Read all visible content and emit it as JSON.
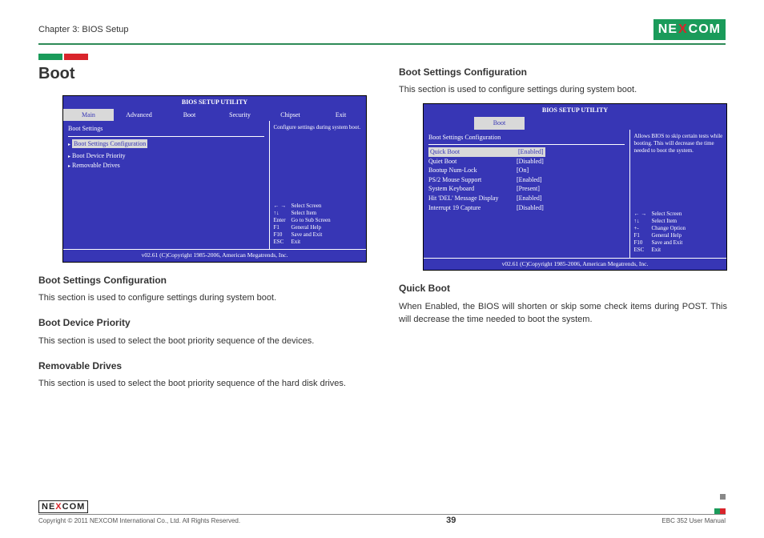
{
  "header": {
    "chapter": "Chapter 3: BIOS Setup",
    "logo_text": "NE COM",
    "logo_x": "X"
  },
  "left": {
    "h1": "Boot",
    "bios": {
      "title": "BIOS SETUP UTILITY",
      "tabs": [
        "Main",
        "Advanced",
        "Boot",
        "Security",
        "Chipset",
        "Exit"
      ],
      "section_label": "Boot Settings",
      "selected": "Boot Settings Configuration",
      "items": [
        "Boot Device Priority",
        "Removable Drives"
      ],
      "help_top": "Configure settings during system boot.",
      "keys": [
        {
          "k": "← →",
          "v": "Select Screen"
        },
        {
          "k": "↑↓",
          "v": "Select Item"
        },
        {
          "k": "Enter",
          "v": "Go to Sub Screen"
        },
        {
          "k": "F1",
          "v": "General Help"
        },
        {
          "k": "F10",
          "v": "Save and Exit"
        },
        {
          "k": "ESC",
          "v": "Exit"
        }
      ],
      "footer": "v02.61 (C)Copyright 1985-2006, American Megatrends, Inc."
    },
    "s1_h": "Boot Settings Configuration",
    "s1_p": "This section is used to configure settings during system boot.",
    "s2_h": "Boot Device Priority",
    "s2_p": "This section is used to select the boot priority sequence of the devices.",
    "s3_h": "Removable Drives",
    "s3_p": "This section is used to select the boot priority sequence of the hard disk drives."
  },
  "right": {
    "h2_top": "Boot Settings Configuration",
    "p_top": "This section is used to configure settings during system boot.",
    "bios": {
      "title": "BIOS SETUP UTILITY",
      "tab": "Boot",
      "section_label": "Boot Settings Configuration",
      "options": [
        {
          "lbl": "Quick Boot",
          "val": "[Enabled]"
        },
        {
          "lbl": "Quiet Boot",
          "val": "[Disabled]"
        },
        {
          "lbl": "Bootup Num-Lock",
          "val": "[On]"
        },
        {
          "lbl": "PS/2 Mouse Support",
          "val": "[Enabled]"
        },
        {
          "lbl": "System Keyboard",
          "val": "[Present]"
        },
        {
          "lbl": "Hit 'DEL' Message Display",
          "val": "[Enabled]"
        },
        {
          "lbl": "Interrupt 19 Capture",
          "val": "[Disabled]"
        }
      ],
      "help_top": "Allows BIOS to skip certain tests while booting. This will decrease the time needed to boot the system.",
      "keys": [
        {
          "k": "← →",
          "v": "Select Screen"
        },
        {
          "k": "↑↓",
          "v": "Select Item"
        },
        {
          "k": "+-",
          "v": "Change Option"
        },
        {
          "k": "F1",
          "v": "General Help"
        },
        {
          "k": "F10",
          "v": "Save and Exit"
        },
        {
          "k": "ESC",
          "v": "Exit"
        }
      ],
      "footer": "v02.61 (C)Copyright 1985-2006, American Megatrends, Inc."
    },
    "s1_h": "Quick Boot",
    "s1_p": "When Enabled, the BIOS will shorten or skip some check items during POST. This will decrease the time needed to boot the system."
  },
  "footer": {
    "copyright": "Copyright © 2011 NEXCOM International Co., Ltd. All Rights Reserved.",
    "page": "39",
    "manual": "EBC 352 User Manual"
  }
}
